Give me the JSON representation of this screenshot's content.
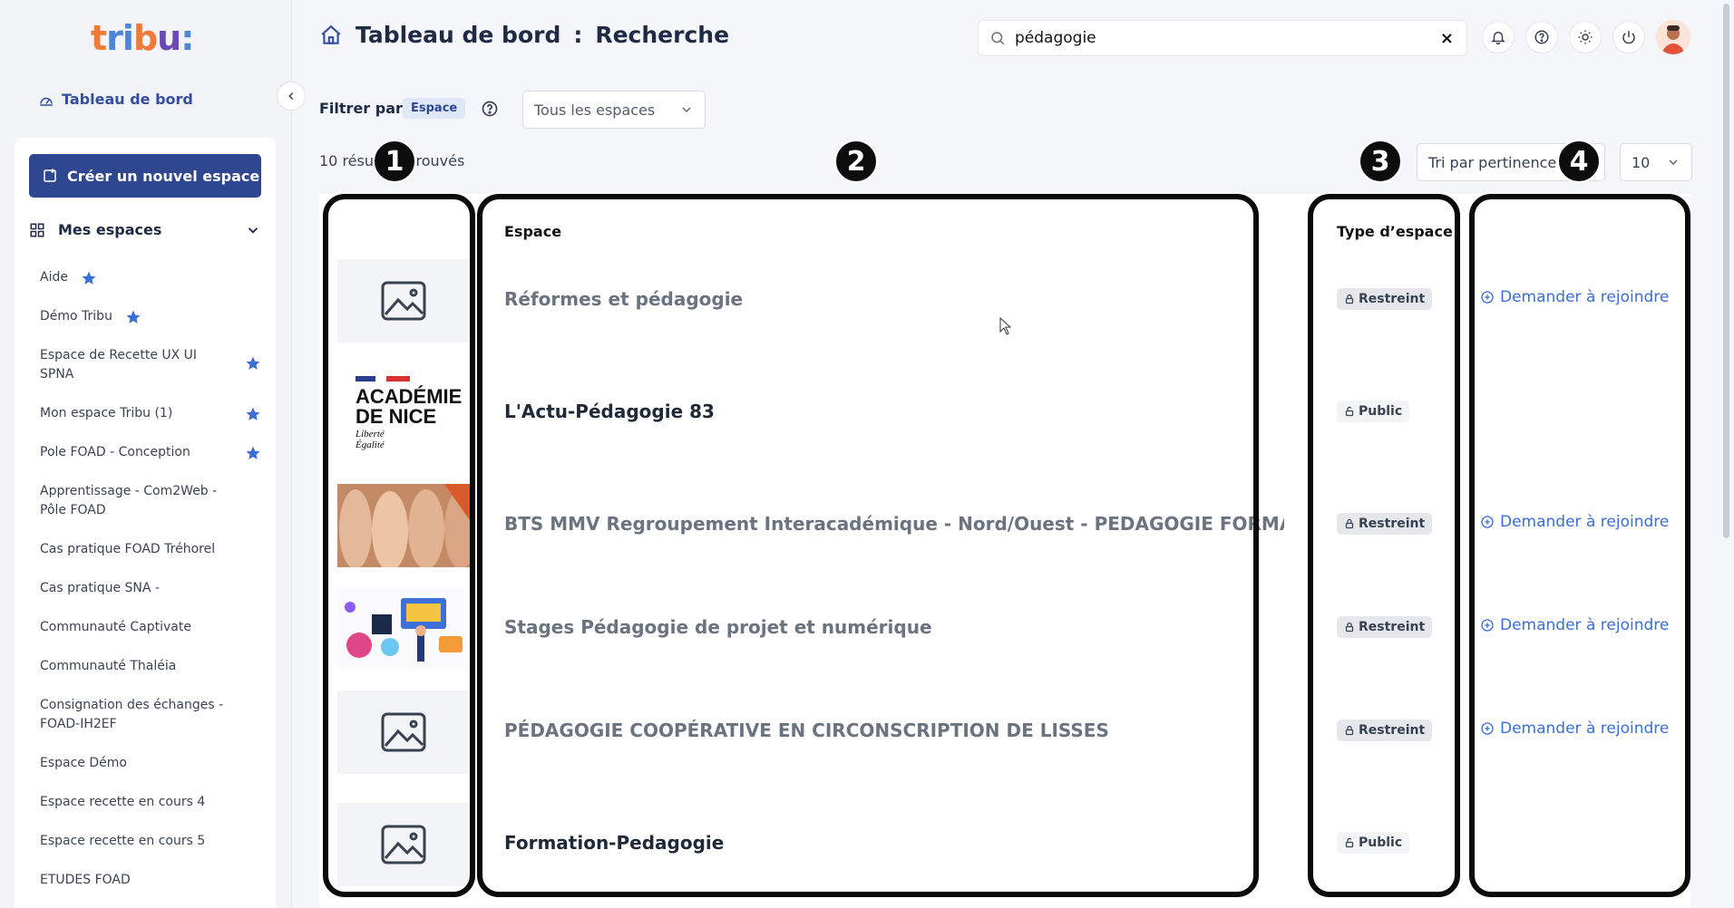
{
  "app": {
    "logo_text": "tribu:",
    "colors": {
      "primary": "#2f4691",
      "link": "#3b6fd8",
      "logo_orange": "#f07a3a",
      "logo_blue": "#4d86d6",
      "logo_purple": "#6a49b5"
    }
  },
  "sidebar": {
    "dashboard_link": "Tableau de bord",
    "create_button": "Créer un nouvel espace",
    "my_spaces_label": "Mes espaces",
    "items": [
      {
        "label": "Aide",
        "favorite": true
      },
      {
        "label": "Démo Tribu",
        "favorite": true
      },
      {
        "label": "Espace de Recette UX UI SPNA",
        "favorite": true
      },
      {
        "label": "Mon espace Tribu (1)",
        "favorite": true
      },
      {
        "label": "Pole FOAD - Conception",
        "favorite": true
      },
      {
        "label": "Apprentissage - Com2Web - Pôle FOAD",
        "favorite": false
      },
      {
        "label": "Cas pratique FOAD Tréhorel",
        "favorite": false
      },
      {
        "label": "Cas pratique SNA -",
        "favorite": false
      },
      {
        "label": "Communauté Captivate",
        "favorite": false
      },
      {
        "label": "Communauté Thaléia",
        "favorite": false
      },
      {
        "label": "Consignation des échanges - FOAD-IH2EF",
        "favorite": false
      },
      {
        "label": "Espace Démo",
        "favorite": false
      },
      {
        "label": "Espace recette en cours 4",
        "favorite": false
      },
      {
        "label": "Espace recette en cours 5",
        "favorite": false
      },
      {
        "label": "ETUDES FOAD",
        "favorite": false
      }
    ]
  },
  "header": {
    "title_main": "Tableau de bord",
    "title_sep": ":",
    "title_sub": "Recherche",
    "search_value": "pédagogie",
    "clear_icon": "×"
  },
  "filter": {
    "label": "Filtrer par:",
    "chip": "Espace",
    "space_select_value": "Tous les espaces"
  },
  "results": {
    "count_text": "10 résultats trouvés",
    "sort_value": "Tri par pertinence",
    "per_page_value": "10"
  },
  "table": {
    "headers": {
      "space": "Espace",
      "type": "Type d’espace"
    },
    "rows": [
      {
        "name": "Réformes et pédagogie",
        "type": "Restreint",
        "thumb": "placeholder",
        "join": "Demander à rejoindre",
        "muted": true
      },
      {
        "name": "L'Actu-Pédagogie 83",
        "type": "Public",
        "thumb": "academie",
        "join": "",
        "muted": false
      },
      {
        "name": "BTS MMV Regroupement Interacadémique - Nord/Ouest - PEDAGOGIE FORMATION",
        "type": "Restreint",
        "thumb": "mannequins",
        "join": "Demander à rejoindre",
        "muted": true
      },
      {
        "name": "Stages Pédagogie de projet et numérique",
        "type": "Restreint",
        "thumb": "illustration",
        "join": "Demander à rejoindre",
        "muted": true
      },
      {
        "name": "PÉDAGOGIE COOPÉRATIVE EN CIRCONSCRIPTION DE LISSES",
        "type": "Restreint",
        "thumb": "placeholder",
        "join": "Demander à rejoindre",
        "muted": true
      },
      {
        "name": "Formation-Pedagogie",
        "type": "Public",
        "thumb": "placeholder",
        "join": "",
        "muted": false
      }
    ],
    "academie_logo": {
      "line1": "ACADÉMIE",
      "line2": "DE NICE",
      "motto1": "Liberté",
      "motto2": "Égalité"
    }
  },
  "annotations": [
    "1",
    "2",
    "3",
    "4"
  ]
}
